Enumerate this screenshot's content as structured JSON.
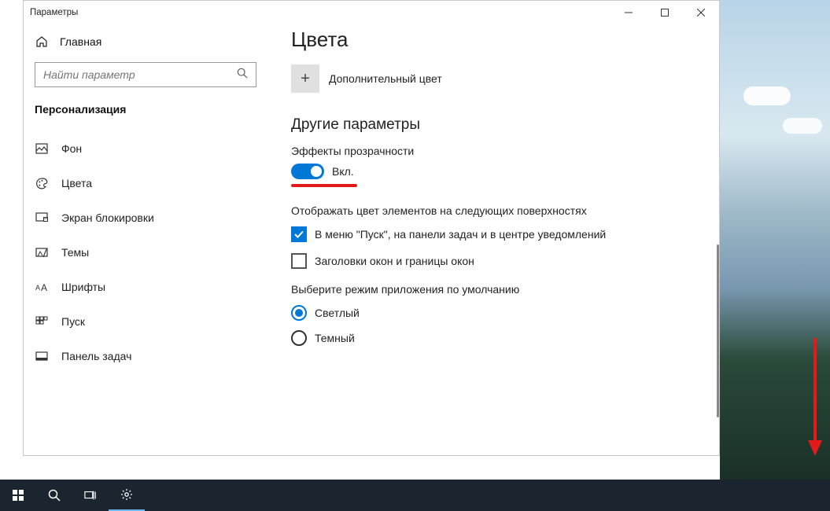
{
  "window": {
    "title": "Параметры"
  },
  "sidebar": {
    "home": "Главная",
    "search_placeholder": "Найти параметр",
    "category": "Персонализация",
    "items": [
      {
        "label": "Фон"
      },
      {
        "label": "Цвета"
      },
      {
        "label": "Экран блокировки"
      },
      {
        "label": "Темы"
      },
      {
        "label": "Шрифты"
      },
      {
        "label": "Пуск"
      },
      {
        "label": "Панель задач"
      }
    ]
  },
  "content": {
    "page_title": "Цвета",
    "add_color_label": "Дополнительный цвет",
    "other_section": "Другие параметры",
    "transparency_label": "Эффекты прозрачности",
    "transparency_state": "Вкл.",
    "surfaces_label": "Отображать цвет элементов на следующих поверхностях",
    "surfaces": [
      {
        "label": "В меню \"Пуск\", на панели задач и в центре уведомлений",
        "checked": true
      },
      {
        "label": "Заголовки окон и границы окон",
        "checked": false
      }
    ],
    "mode_label": "Выберите режим приложения по умолчанию",
    "modes": [
      {
        "label": "Светлый",
        "selected": true
      },
      {
        "label": "Темный",
        "selected": false
      }
    ]
  }
}
